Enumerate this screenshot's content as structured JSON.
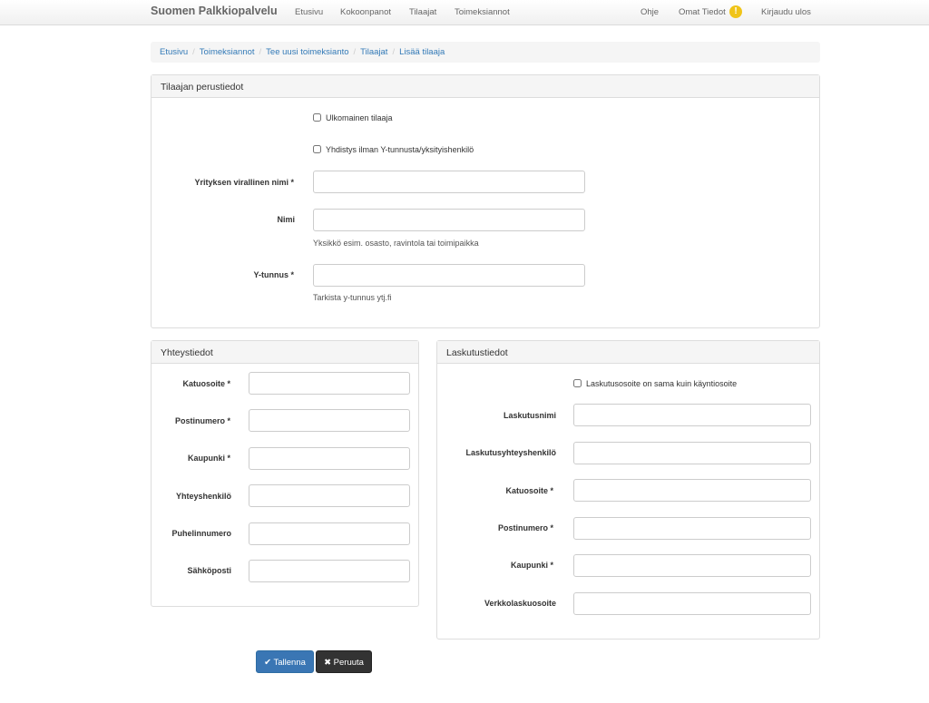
{
  "nav": {
    "brand": "Suomen Palkkiopalvelu",
    "links": [
      "Etusivu",
      "Kokoonpanot",
      "Tilaajat",
      "Toimeksiannot"
    ],
    "right_links": [
      "Ohje",
      "Omat Tiedot",
      "Kirjaudu ulos"
    ],
    "badge": "!"
  },
  "breadcrumb": [
    "Etusivu",
    "Toimeksiannot",
    "Tee uusi toimeksianto",
    "Tilaajat",
    "Lisää tilaaja"
  ],
  "basic": {
    "heading": "Tilaajan perustiedot",
    "foreign_label": "Ulkomainen tilaaja",
    "assoc_label": "Yhdistys ilman Y-tunnusta/yksityishenkilö",
    "official_name_label": "Yrityksen virallinen nimi *",
    "name_label": "Nimi",
    "name_help": "Yksikkö esim. osasto, ravintola tai toimipaikka",
    "ytunnus_label": "Y-tunnus *",
    "ytunnus_help": "Tarkista y-tunnus ytj.fi"
  },
  "contact": {
    "heading": "Yhteystiedot",
    "fields": [
      "Katuosoite *",
      "Postinumero *",
      "Kaupunki *",
      "Yhteyshenkilö",
      "Puhelinnumero",
      "Sähköposti"
    ]
  },
  "billing": {
    "heading": "Laskutustiedot",
    "same_label": "Laskutusosoite on sama kuin käyntiosoite",
    "fields": [
      "Laskutusnimi",
      "Laskutusyhteyshenkilö",
      "Katuosoite *",
      "Postinumero *",
      "Kaupunki *",
      "Verkkolaskuosoite"
    ]
  },
  "buttons": {
    "save": "✔ Tallenna",
    "cancel": "✖ Peruuta"
  }
}
